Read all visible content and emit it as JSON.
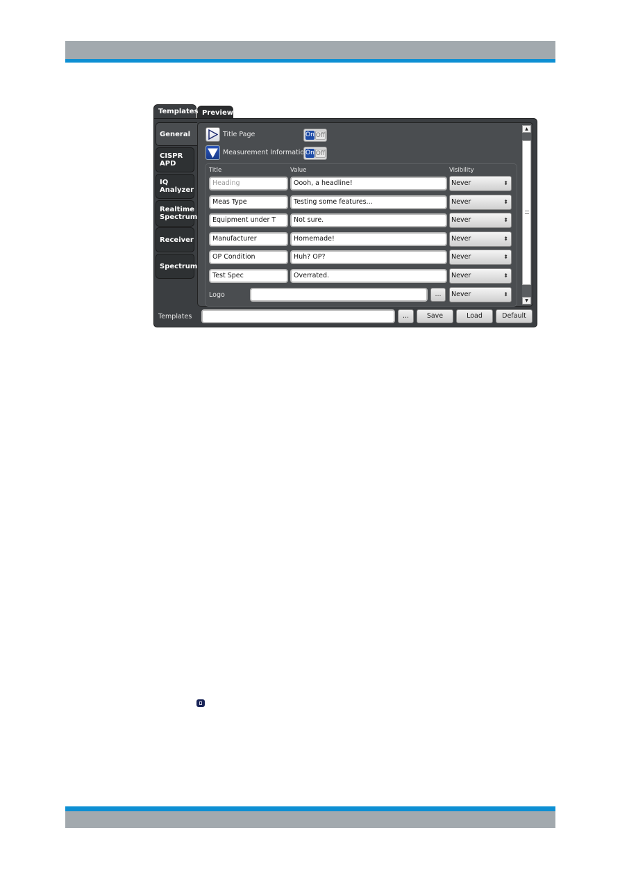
{
  "dialog": {
    "tabs": [
      {
        "label": "Templates",
        "active": true
      },
      {
        "label": "Preview",
        "active": false
      }
    ],
    "side_tabs": [
      {
        "label": "General",
        "active": true
      },
      {
        "label": "CISPR APD",
        "lines": [
          "CISPR",
          "APD"
        ]
      },
      {
        "label": "IQ Analyzer",
        "lines": [
          "IQ",
          "Analyzer"
        ]
      },
      {
        "label": "Realtime Spectrum",
        "lines": [
          "Realtime",
          "Spectrum"
        ]
      },
      {
        "label": "Receiver"
      },
      {
        "label": "Spectrum"
      }
    ],
    "sections": [
      {
        "label": "Title Page",
        "expanded": false,
        "toggle_on": "On",
        "toggle_off": "Off",
        "state": "On"
      },
      {
        "label": "Measurement Information",
        "expanded": true,
        "toggle_on": "On",
        "toggle_off": "Off",
        "state": "On"
      }
    ],
    "columns": {
      "title": "Title",
      "value": "Value",
      "visibility": "Visibility"
    },
    "rows": [
      {
        "title": "",
        "title_placeholder": "Heading",
        "value": "Oooh, a headline!",
        "visibility": "Never"
      },
      {
        "title": "Meas Type",
        "value": "Testing some features...",
        "visibility": "Never"
      },
      {
        "title": "Equipment under T",
        "value": "Not sure.",
        "visibility": "Never"
      },
      {
        "title": "Manufacturer",
        "value": "Homemade!",
        "visibility": "Never"
      },
      {
        "title": "OP Condition",
        "value": "Huh? OP?",
        "visibility": "Never"
      },
      {
        "title": "Test Spec",
        "value": "Overrated.",
        "visibility": "Never"
      }
    ],
    "logo": {
      "label": "Logo",
      "value": "",
      "browse_label": "...",
      "visibility": "Never"
    },
    "templates_bar": {
      "label": "Templates",
      "value": "",
      "browse_label": "...",
      "save_label": "Save",
      "load_label": "Load",
      "default_label": "Default"
    },
    "scrollbar": {
      "up": "▲",
      "down": "▼"
    }
  },
  "colors": {
    "accent_blue": "#0d8fd3",
    "band_gray": "#a2a9ae",
    "toggle_on": "#1d4ba6"
  }
}
